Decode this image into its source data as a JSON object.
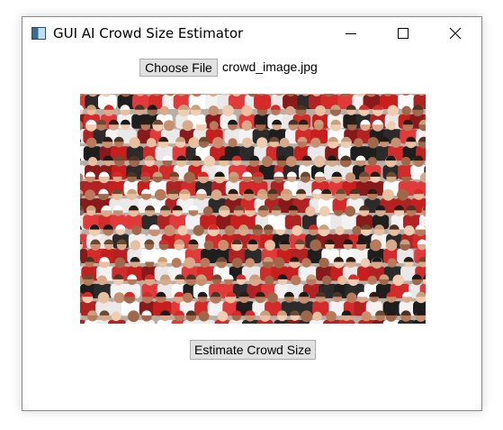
{
  "window": {
    "title": "GUI AI Crowd Size Estimator",
    "icon": "app-window-icon",
    "controls": [
      "minimize-icon",
      "maximize-icon",
      "close-icon"
    ]
  },
  "file_picker": {
    "button_label": "Choose File",
    "selected_file": "crowd_image.jpg"
  },
  "image": {
    "subject": "crowd-photo",
    "dominant_colors": [
      "#d42a2a",
      "#f2f2f2",
      "#1e1e1e",
      "#c9a07c"
    ]
  },
  "actions": {
    "estimate_label": "Estimate Crowd Size"
  }
}
